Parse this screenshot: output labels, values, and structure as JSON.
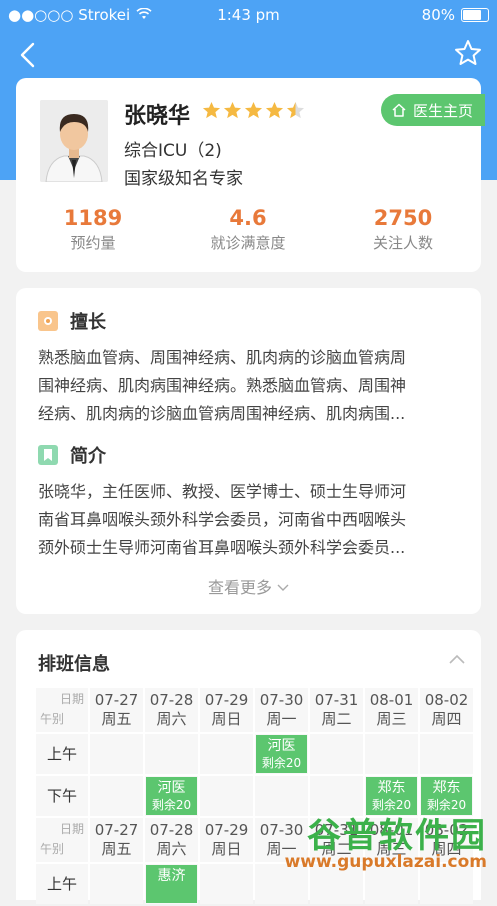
{
  "statusbar": {
    "carrier": "●●○○○ Strokei",
    "time": "1:43 pm",
    "battery": "80%"
  },
  "doctor": {
    "name": "张晓华",
    "rating": 4.5,
    "home_button": "医生主页",
    "department": "综合ICU（2)",
    "title": "国家级知名专家",
    "stats": [
      {
        "value": "1189",
        "label": "预约量"
      },
      {
        "value": "4.6",
        "label": "就诊满意度"
      },
      {
        "value": "2750",
        "label": "关注人数"
      }
    ]
  },
  "specialty": {
    "heading": "擅长",
    "lines": [
      "熟悉脑血管病、周围神经病、肌肉病的诊脑血管病周",
      "围神经病、肌肉病围神经病。熟悉脑血管病、周围神",
      "经病、肌肉病的诊脑血管病周围神经病、肌肉病围..."
    ]
  },
  "intro": {
    "heading": "简介",
    "lines": [
      "张晓华，主任医师、教授、医学博士、硕士生导师河",
      "南省耳鼻咽喉头颈外科学会委员，河南省中西咽喉头",
      "颈外硕士生导师河南省耳鼻咽喉头颈外科学会委员..."
    ],
    "more": "查看更多"
  },
  "schedule": {
    "title": "排班信息",
    "corner_date": "日期",
    "corner_slot": "午别",
    "morning": "上午",
    "afternoon": "下午",
    "week1": [
      {
        "date": "07-27",
        "day": "周五"
      },
      {
        "date": "07-28",
        "day": "周六"
      },
      {
        "date": "07-29",
        "day": "周日"
      },
      {
        "date": "07-30",
        "day": "周一"
      },
      {
        "date": "07-31",
        "day": "周二"
      },
      {
        "date": "08-01",
        "day": "周三"
      },
      {
        "date": "08-02",
        "day": "周四"
      }
    ],
    "week1_am": [
      "",
      "",
      "",
      "河医|剩余20",
      "",
      "",
      ""
    ],
    "week1_pm": [
      "",
      "河医|剩余20",
      "",
      "",
      "",
      "郑东|剩余20",
      "郑东|剩余20"
    ],
    "week2": [
      {
        "date": "07-27",
        "day": "周五"
      },
      {
        "date": "07-28",
        "day": "周六"
      },
      {
        "date": "07-29",
        "day": "周日"
      },
      {
        "date": "07-30",
        "day": "周一"
      },
      {
        "date": "07-31",
        "day": "周二"
      },
      {
        "date": "08-01",
        "day": "周三"
      },
      {
        "date": "08-02",
        "day": "周四"
      }
    ],
    "week2_am": [
      "",
      "惠济",
      "",
      "",
      "",
      "",
      ""
    ]
  },
  "watermark": {
    "brand": "谷普软件园",
    "url": "www.gupuxlazai.com"
  },
  "colors": {
    "header": "#4da3f5",
    "accent_orange": "#e8793a",
    "green": "#5cc66f"
  }
}
